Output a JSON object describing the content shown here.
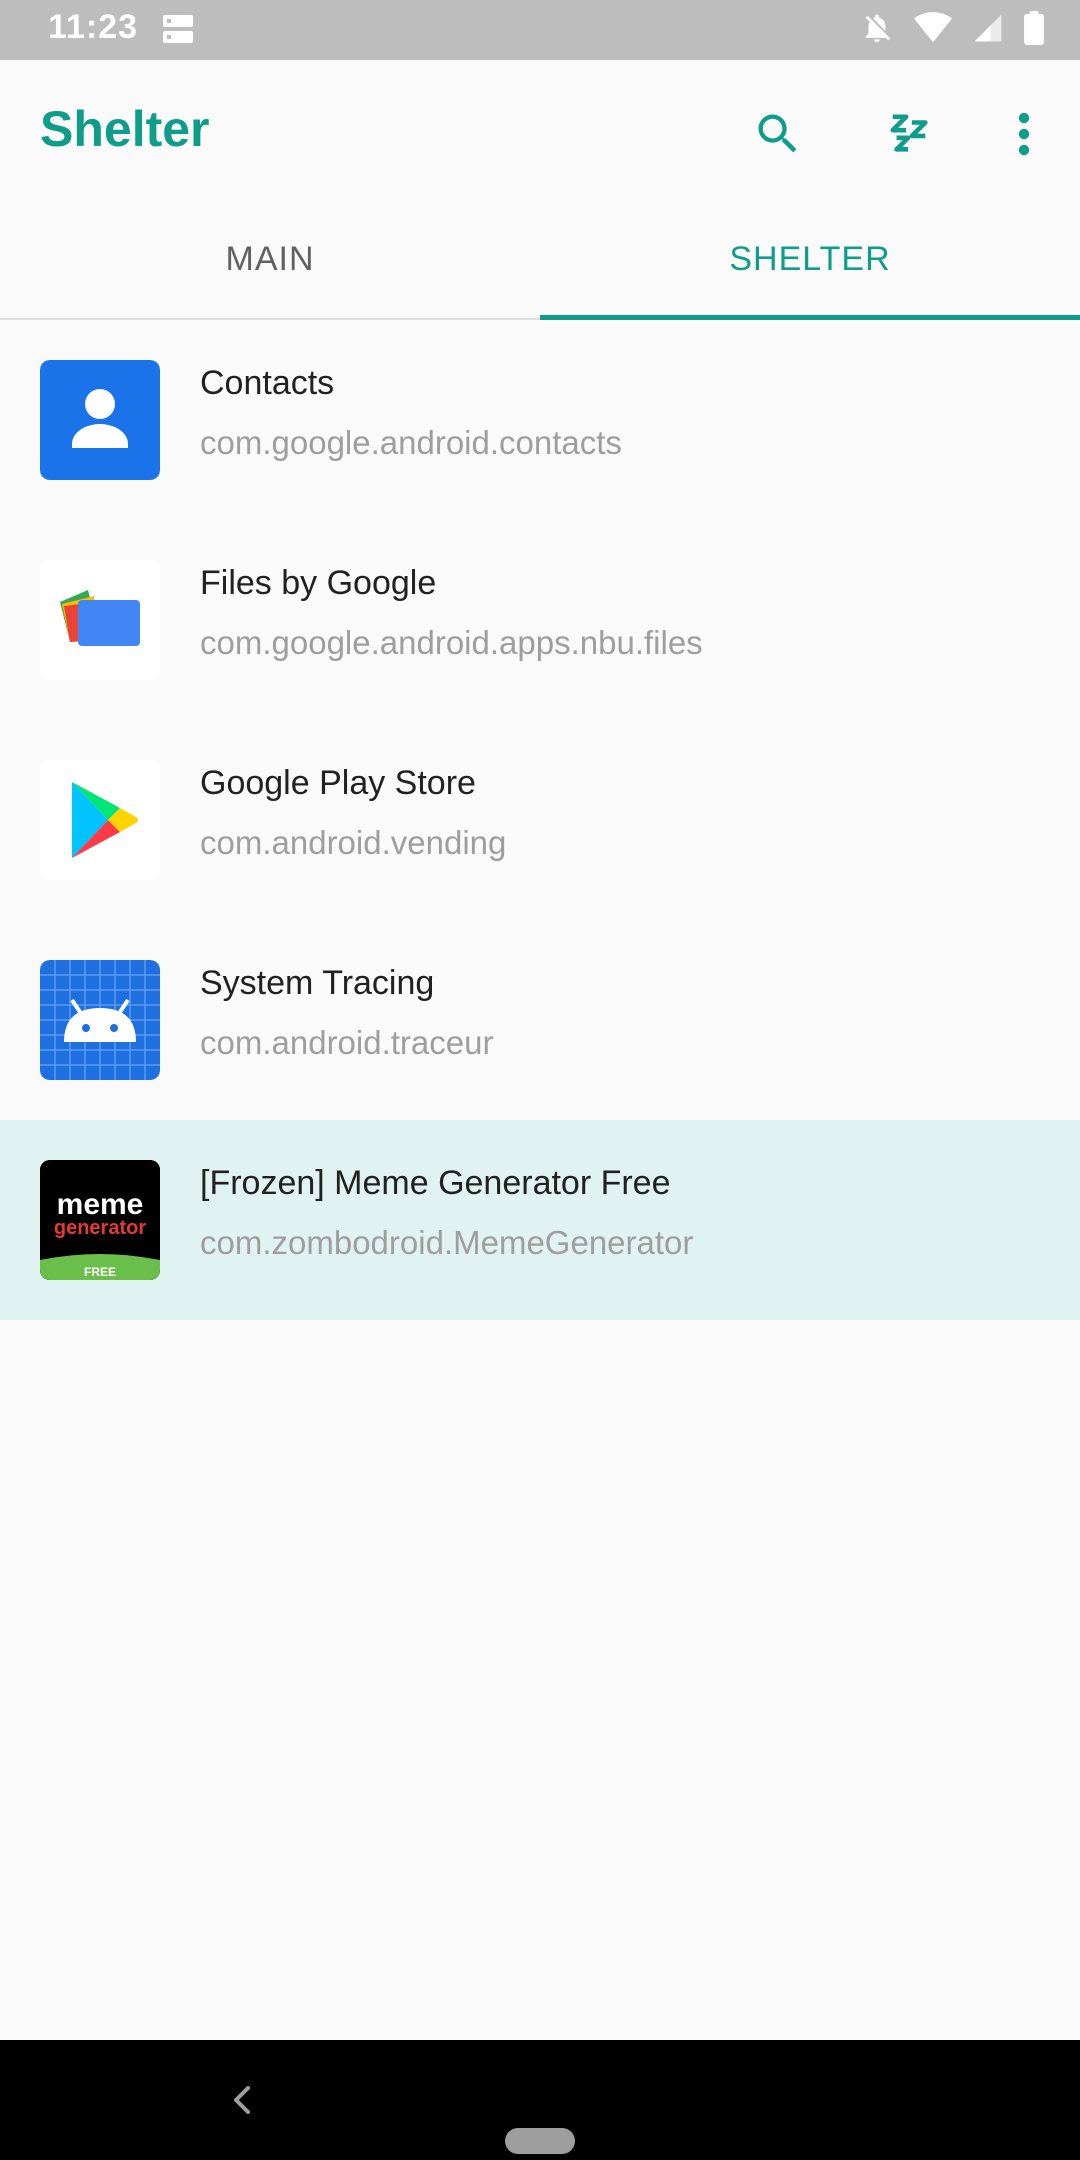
{
  "status_bar": {
    "time": "11:23",
    "icons": [
      "storage-icon",
      "notifications-off-icon",
      "wifi-icon",
      "signal-icon",
      "battery-icon"
    ]
  },
  "app_bar": {
    "title": "Shelter",
    "actions": [
      "search-icon",
      "sleep-icon",
      "more-vert-icon"
    ],
    "accent_color": "#0f9d8a"
  },
  "tabs": [
    {
      "label": "MAIN",
      "selected": false
    },
    {
      "label": "SHELTER",
      "selected": true
    }
  ],
  "apps": [
    {
      "name": "Contacts",
      "package": "com.google.android.contacts",
      "icon": "contacts-icon",
      "highlighted": false
    },
    {
      "name": "Files by Google",
      "package": "com.google.android.apps.nbu.files",
      "icon": "files-icon",
      "highlighted": false
    },
    {
      "name": "Google Play Store",
      "package": "com.android.vending",
      "icon": "play-store-icon",
      "highlighted": false
    },
    {
      "name": "System Tracing",
      "package": "com.android.traceur",
      "icon": "system-tracing-icon",
      "highlighted": false
    },
    {
      "name": "[Frozen] Meme Generator Free",
      "package": "com.zombodroid.MemeGenerator",
      "icon": "meme-generator-icon",
      "highlighted": true,
      "icon_text": {
        "line1": "meme",
        "line2": "generator",
        "badge": "FREE"
      }
    }
  ],
  "nav_bar": {
    "buttons": [
      "back-icon",
      "home-pill"
    ]
  }
}
